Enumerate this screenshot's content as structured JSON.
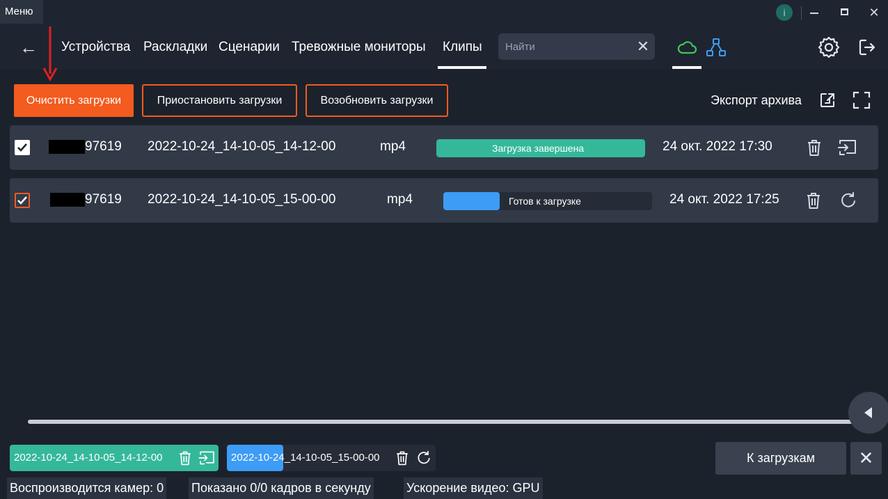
{
  "titlebar": {
    "menu_label": "Меню",
    "info_label": "i"
  },
  "nav": {
    "items": [
      "Устройства",
      "Раскладки",
      "Сценарии",
      "Тревожные мониторы",
      "Клипы"
    ],
    "active": "Клипы",
    "search_placeholder": "Найти"
  },
  "toolbar": {
    "clear_label": "Очистить загрузки",
    "pause_label": "Приостановить загрузки",
    "resume_label": "Возобновить загрузки",
    "export_label": "Экспорт архива"
  },
  "rows": [
    {
      "checked": true,
      "camera_suffix": "97619",
      "filename": "2022-10-24_14-10-05_14-12-00",
      "format": "mp4",
      "status": "Загрузка завершена",
      "progress": 1.0,
      "status_color": "#35b89a",
      "date": "24 окт. 2022 17:30",
      "actions": [
        "trash-icon",
        "open-in-player-icon"
      ]
    },
    {
      "checked": true,
      "camera_suffix": "97619",
      "filename": "2022-10-24_14-10-05_15-00-00",
      "format": "mp4",
      "status": "Готов к загрузке",
      "progress": 0.27,
      "status_color": "#3d9cf5",
      "date": "24 окт. 2022 17:25",
      "actions": [
        "trash-icon",
        "retry-icon"
      ]
    }
  ],
  "bottom": {
    "chips": [
      {
        "label": "2022-10-24_14-10-05_14-12-00",
        "progress": 1.0,
        "color": "#35b89a"
      },
      {
        "label": "2022-10-24_14-10-05_15-00-00",
        "progress": 0.27,
        "color": "#3d9cf5"
      }
    ],
    "to_downloads_label": "К загрузкам"
  },
  "statusbar": {
    "cameras": "Воспроизводится камер: 0",
    "fps": "Показано 0/0 кадров в секунду",
    "accel": "Ускорение видео: GPU"
  },
  "colors": {
    "accent": "#f35b1f",
    "success": "#35b89a",
    "info": "#3d9cf5",
    "cloud_icon": "#3ec95a",
    "network_icon": "#3d9cf5"
  }
}
